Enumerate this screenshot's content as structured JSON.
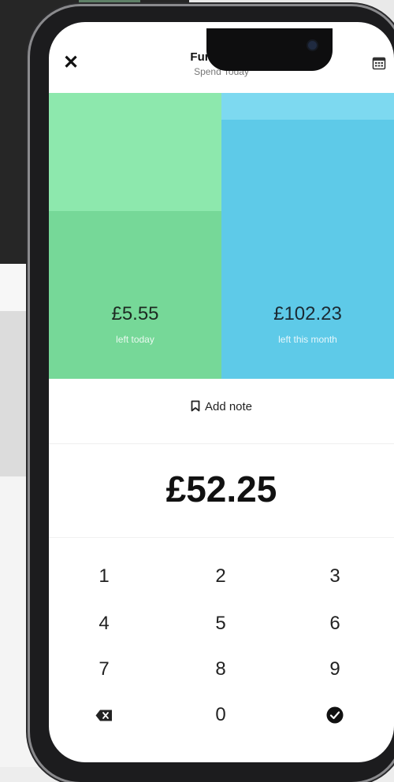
{
  "header": {
    "close_icon": "close-icon",
    "title": "Fun Money",
    "subtitle": "Spend Today",
    "calendar_icon": "calendar-icon"
  },
  "budget": {
    "left_amount": "£5.55",
    "left_caption": "left today",
    "right_amount": "£102.23",
    "right_caption": "left this month",
    "colors": {
      "left": "#76d898",
      "left_light": "#8de8ad",
      "right": "#5ecae8",
      "right_light": "#7dd9f0"
    }
  },
  "note": {
    "label": "Add note",
    "icon": "bookmark-icon"
  },
  "entry": {
    "amount": "£52.25"
  },
  "keypad": {
    "keys": [
      "1",
      "2",
      "3",
      "4",
      "5",
      "6",
      "7",
      "8",
      "9",
      "0"
    ],
    "backspace_icon": "backspace-icon",
    "confirm_icon": "check-circle-icon"
  }
}
